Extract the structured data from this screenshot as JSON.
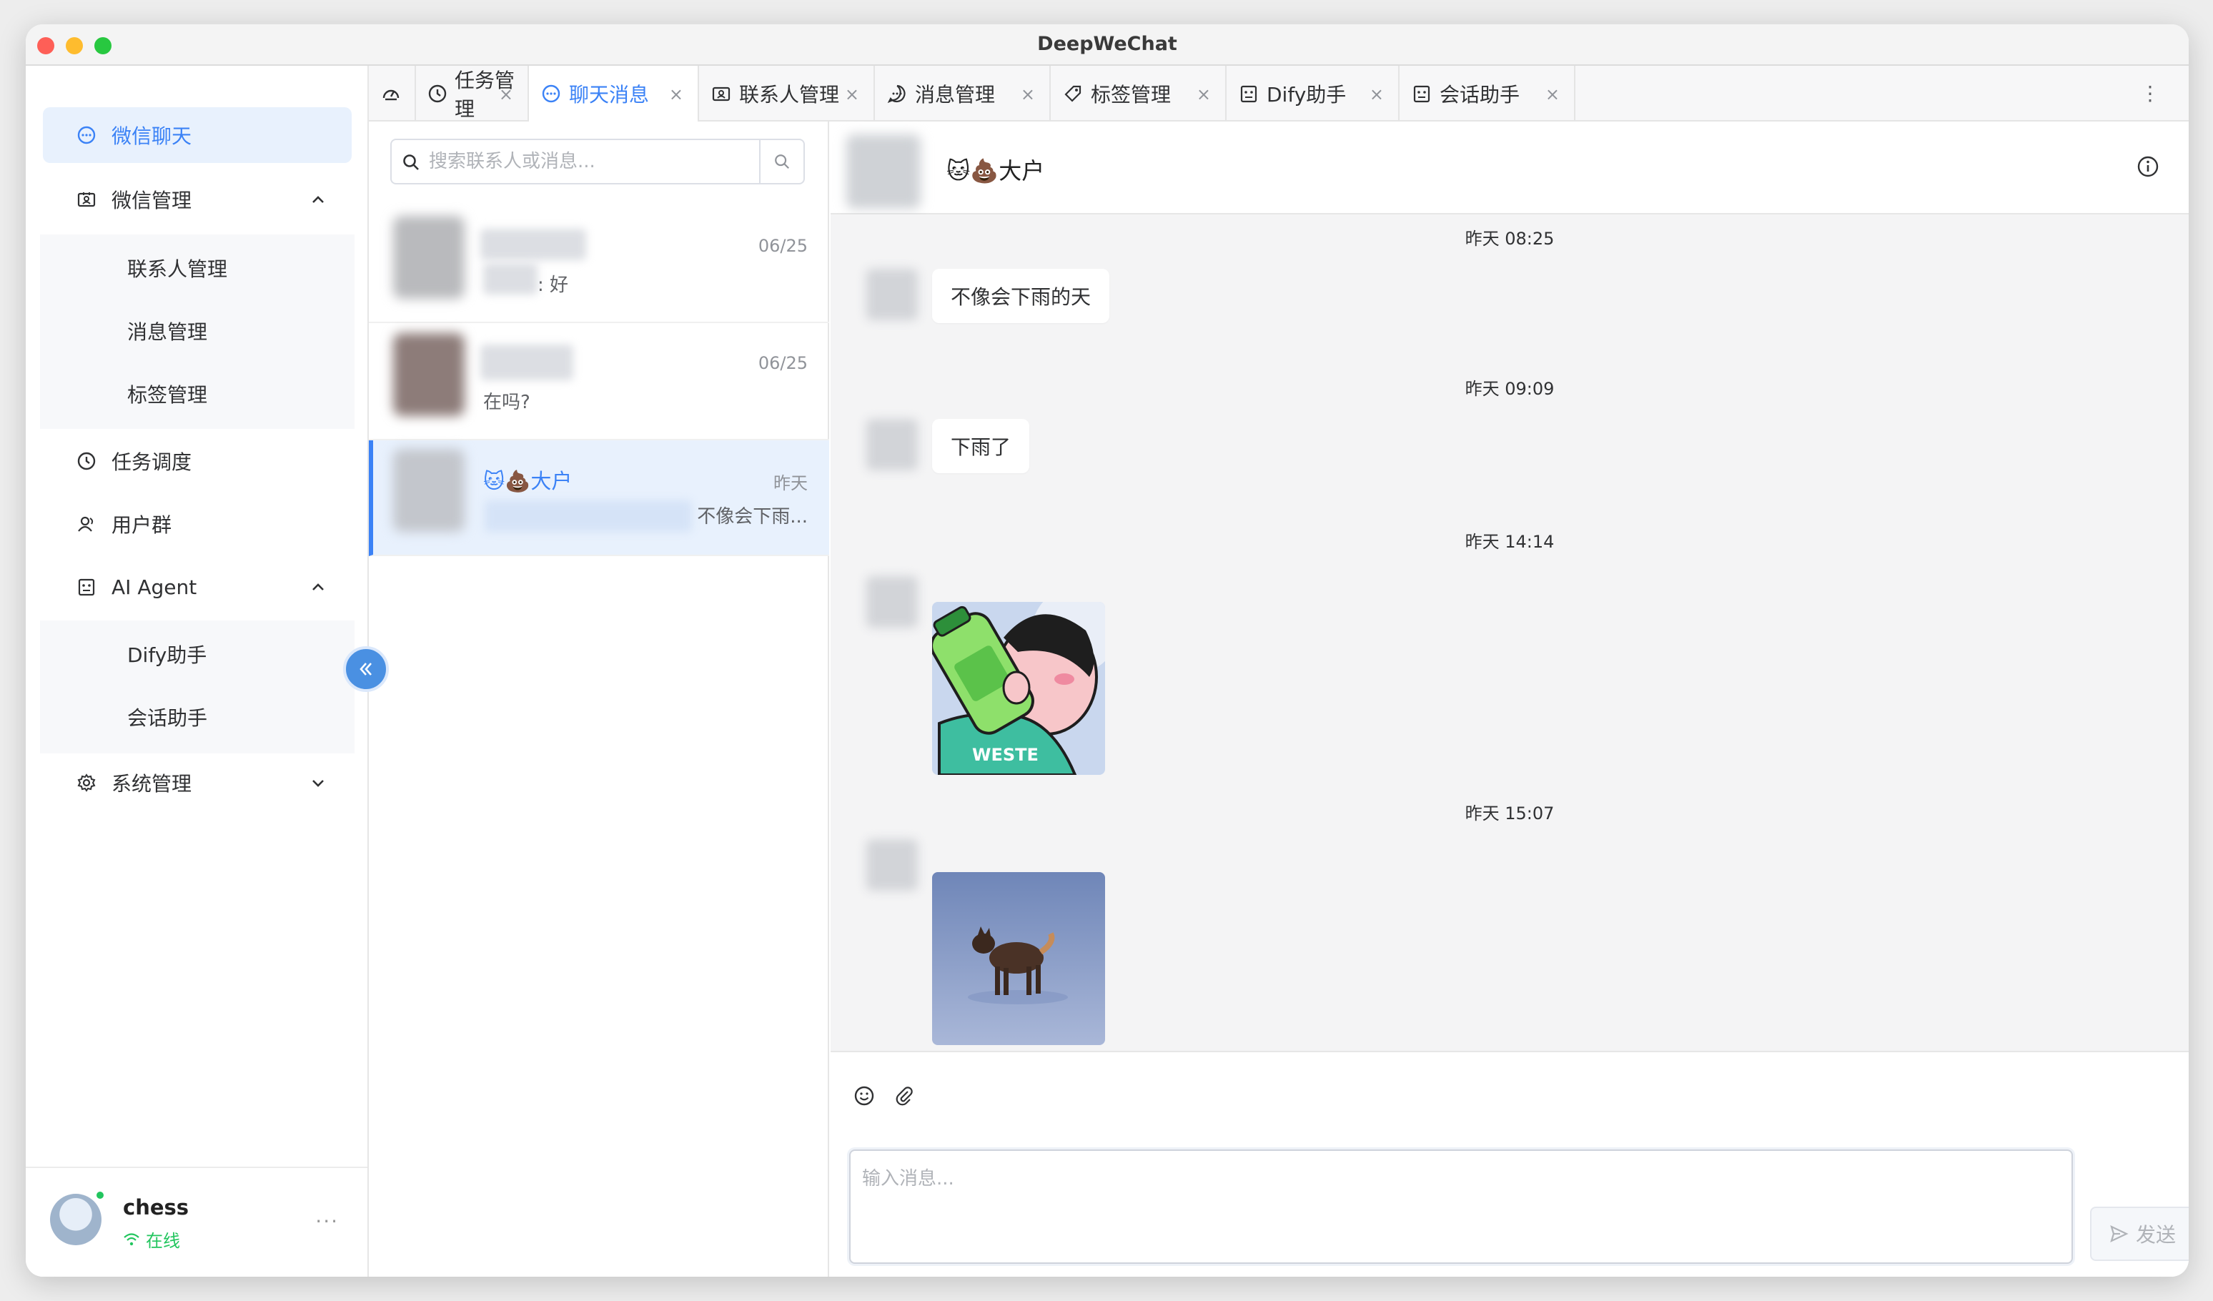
{
  "window": {
    "title": "DeepWeChat"
  },
  "sidebar": {
    "items": [
      {
        "label": "微信聊天",
        "icon": "chat-icon",
        "active": true
      },
      {
        "label": "微信管理",
        "icon": "contact-card-icon",
        "expanded": true,
        "children": [
          "联系人管理",
          "消息管理",
          "标签管理"
        ]
      },
      {
        "label": "任务调度",
        "icon": "clock-icon"
      },
      {
        "label": "用户群",
        "icon": "users-icon"
      },
      {
        "label": "AI Agent",
        "icon": "robot-icon",
        "expanded": true,
        "children": [
          "Dify助手",
          "会话助手"
        ]
      },
      {
        "label": "系统管理",
        "icon": "gear-icon",
        "expanded": false
      }
    ],
    "user": {
      "name": "chess",
      "status": "在线",
      "more": "···"
    }
  },
  "tabs": [
    {
      "label": "",
      "icon": "dashboard-icon",
      "closable": false
    },
    {
      "label": "任务管理",
      "icon": "clock-icon",
      "closable": true
    },
    {
      "label": "聊天消息",
      "icon": "chat-icon",
      "closable": true,
      "active": true
    },
    {
      "label": "联系人管理",
      "icon": "contact-card-icon",
      "closable": true
    },
    {
      "label": "消息管理",
      "icon": "message-icon",
      "closable": true
    },
    {
      "label": "标签管理",
      "icon": "tag-icon",
      "closable": true
    },
    {
      "label": "Dify助手",
      "icon": "robot-icon",
      "closable": true
    },
    {
      "label": "会话助手",
      "icon": "robot-icon",
      "closable": true
    }
  ],
  "tab_close": "×",
  "tab_more": "⋮",
  "search": {
    "placeholder": "搜索联系人或消息..."
  },
  "conversations": [
    {
      "name": "",
      "time": "06/25",
      "preview": ": 好"
    },
    {
      "name": "",
      "time": "06/25",
      "preview": "在吗?"
    },
    {
      "name": "🐱💩大户",
      "time": "昨天",
      "preview": "不像会下雨...",
      "active": true
    }
  ],
  "chat": {
    "title": "🐱💩大户",
    "messages": [
      {
        "time": "昨天 08:25",
        "type": "text",
        "text": "不像会下雨的天"
      },
      {
        "time": "昨天 09:09",
        "type": "text",
        "text": "下雨了"
      },
      {
        "time": "昨天 14:14",
        "type": "image",
        "image": "cartoon-drinking-sticker"
      },
      {
        "time": "昨天 15:07",
        "type": "image",
        "image": "dog-in-snow-photo"
      }
    ]
  },
  "composer": {
    "placeholder": "输入消息...",
    "send_label": "发送"
  },
  "colors": {
    "accent": "#3b82f6",
    "online": "#22c55e",
    "active_bg": "#e8f1fd"
  }
}
